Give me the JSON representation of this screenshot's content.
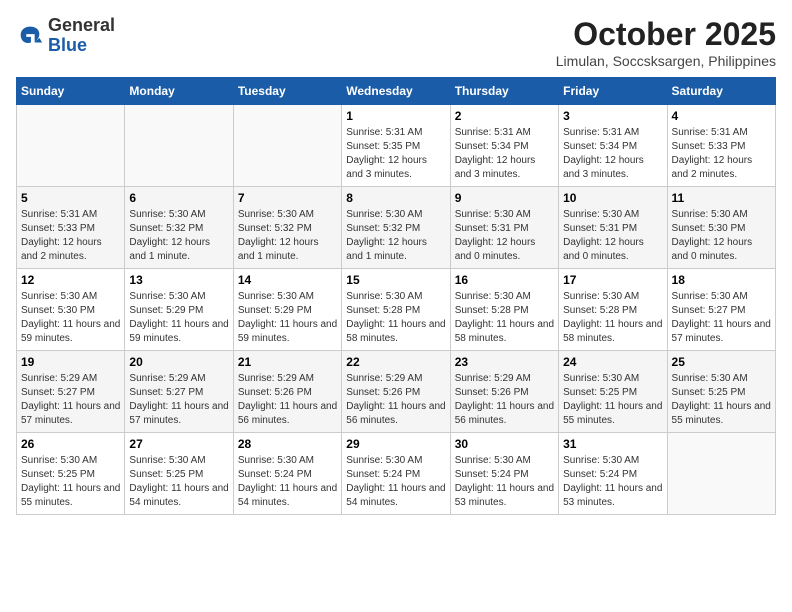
{
  "header": {
    "logo_general": "General",
    "logo_blue": "Blue",
    "month_title": "October 2025",
    "location": "Limulan, Soccsksargen, Philippines"
  },
  "weekdays": [
    "Sunday",
    "Monday",
    "Tuesday",
    "Wednesday",
    "Thursday",
    "Friday",
    "Saturday"
  ],
  "weeks": [
    [
      {
        "day": "",
        "sunrise": "",
        "sunset": "",
        "daylight": ""
      },
      {
        "day": "",
        "sunrise": "",
        "sunset": "",
        "daylight": ""
      },
      {
        "day": "",
        "sunrise": "",
        "sunset": "",
        "daylight": ""
      },
      {
        "day": "1",
        "sunrise": "Sunrise: 5:31 AM",
        "sunset": "Sunset: 5:35 PM",
        "daylight": "Daylight: 12 hours and 3 minutes."
      },
      {
        "day": "2",
        "sunrise": "Sunrise: 5:31 AM",
        "sunset": "Sunset: 5:34 PM",
        "daylight": "Daylight: 12 hours and 3 minutes."
      },
      {
        "day": "3",
        "sunrise": "Sunrise: 5:31 AM",
        "sunset": "Sunset: 5:34 PM",
        "daylight": "Daylight: 12 hours and 3 minutes."
      },
      {
        "day": "4",
        "sunrise": "Sunrise: 5:31 AM",
        "sunset": "Sunset: 5:33 PM",
        "daylight": "Daylight: 12 hours and 2 minutes."
      }
    ],
    [
      {
        "day": "5",
        "sunrise": "Sunrise: 5:31 AM",
        "sunset": "Sunset: 5:33 PM",
        "daylight": "Daylight: 12 hours and 2 minutes."
      },
      {
        "day": "6",
        "sunrise": "Sunrise: 5:30 AM",
        "sunset": "Sunset: 5:32 PM",
        "daylight": "Daylight: 12 hours and 1 minute."
      },
      {
        "day": "7",
        "sunrise": "Sunrise: 5:30 AM",
        "sunset": "Sunset: 5:32 PM",
        "daylight": "Daylight: 12 hours and 1 minute."
      },
      {
        "day": "8",
        "sunrise": "Sunrise: 5:30 AM",
        "sunset": "Sunset: 5:32 PM",
        "daylight": "Daylight: 12 hours and 1 minute."
      },
      {
        "day": "9",
        "sunrise": "Sunrise: 5:30 AM",
        "sunset": "Sunset: 5:31 PM",
        "daylight": "Daylight: 12 hours and 0 minutes."
      },
      {
        "day": "10",
        "sunrise": "Sunrise: 5:30 AM",
        "sunset": "Sunset: 5:31 PM",
        "daylight": "Daylight: 12 hours and 0 minutes."
      },
      {
        "day": "11",
        "sunrise": "Sunrise: 5:30 AM",
        "sunset": "Sunset: 5:30 PM",
        "daylight": "Daylight: 12 hours and 0 minutes."
      }
    ],
    [
      {
        "day": "12",
        "sunrise": "Sunrise: 5:30 AM",
        "sunset": "Sunset: 5:30 PM",
        "daylight": "Daylight: 11 hours and 59 minutes."
      },
      {
        "day": "13",
        "sunrise": "Sunrise: 5:30 AM",
        "sunset": "Sunset: 5:29 PM",
        "daylight": "Daylight: 11 hours and 59 minutes."
      },
      {
        "day": "14",
        "sunrise": "Sunrise: 5:30 AM",
        "sunset": "Sunset: 5:29 PM",
        "daylight": "Daylight: 11 hours and 59 minutes."
      },
      {
        "day": "15",
        "sunrise": "Sunrise: 5:30 AM",
        "sunset": "Sunset: 5:28 PM",
        "daylight": "Daylight: 11 hours and 58 minutes."
      },
      {
        "day": "16",
        "sunrise": "Sunrise: 5:30 AM",
        "sunset": "Sunset: 5:28 PM",
        "daylight": "Daylight: 11 hours and 58 minutes."
      },
      {
        "day": "17",
        "sunrise": "Sunrise: 5:30 AM",
        "sunset": "Sunset: 5:28 PM",
        "daylight": "Daylight: 11 hours and 58 minutes."
      },
      {
        "day": "18",
        "sunrise": "Sunrise: 5:30 AM",
        "sunset": "Sunset: 5:27 PM",
        "daylight": "Daylight: 11 hours and 57 minutes."
      }
    ],
    [
      {
        "day": "19",
        "sunrise": "Sunrise: 5:29 AM",
        "sunset": "Sunset: 5:27 PM",
        "daylight": "Daylight: 11 hours and 57 minutes."
      },
      {
        "day": "20",
        "sunrise": "Sunrise: 5:29 AM",
        "sunset": "Sunset: 5:27 PM",
        "daylight": "Daylight: 11 hours and 57 minutes."
      },
      {
        "day": "21",
        "sunrise": "Sunrise: 5:29 AM",
        "sunset": "Sunset: 5:26 PM",
        "daylight": "Daylight: 11 hours and 56 minutes."
      },
      {
        "day": "22",
        "sunrise": "Sunrise: 5:29 AM",
        "sunset": "Sunset: 5:26 PM",
        "daylight": "Daylight: 11 hours and 56 minutes."
      },
      {
        "day": "23",
        "sunrise": "Sunrise: 5:29 AM",
        "sunset": "Sunset: 5:26 PM",
        "daylight": "Daylight: 11 hours and 56 minutes."
      },
      {
        "day": "24",
        "sunrise": "Sunrise: 5:30 AM",
        "sunset": "Sunset: 5:25 PM",
        "daylight": "Daylight: 11 hours and 55 minutes."
      },
      {
        "day": "25",
        "sunrise": "Sunrise: 5:30 AM",
        "sunset": "Sunset: 5:25 PM",
        "daylight": "Daylight: 11 hours and 55 minutes."
      }
    ],
    [
      {
        "day": "26",
        "sunrise": "Sunrise: 5:30 AM",
        "sunset": "Sunset: 5:25 PM",
        "daylight": "Daylight: 11 hours and 55 minutes."
      },
      {
        "day": "27",
        "sunrise": "Sunrise: 5:30 AM",
        "sunset": "Sunset: 5:25 PM",
        "daylight": "Daylight: 11 hours and 54 minutes."
      },
      {
        "day": "28",
        "sunrise": "Sunrise: 5:30 AM",
        "sunset": "Sunset: 5:24 PM",
        "daylight": "Daylight: 11 hours and 54 minutes."
      },
      {
        "day": "29",
        "sunrise": "Sunrise: 5:30 AM",
        "sunset": "Sunset: 5:24 PM",
        "daylight": "Daylight: 11 hours and 54 minutes."
      },
      {
        "day": "30",
        "sunrise": "Sunrise: 5:30 AM",
        "sunset": "Sunset: 5:24 PM",
        "daylight": "Daylight: 11 hours and 53 minutes."
      },
      {
        "day": "31",
        "sunrise": "Sunrise: 5:30 AM",
        "sunset": "Sunset: 5:24 PM",
        "daylight": "Daylight: 11 hours and 53 minutes."
      },
      {
        "day": "",
        "sunrise": "",
        "sunset": "",
        "daylight": ""
      }
    ]
  ]
}
